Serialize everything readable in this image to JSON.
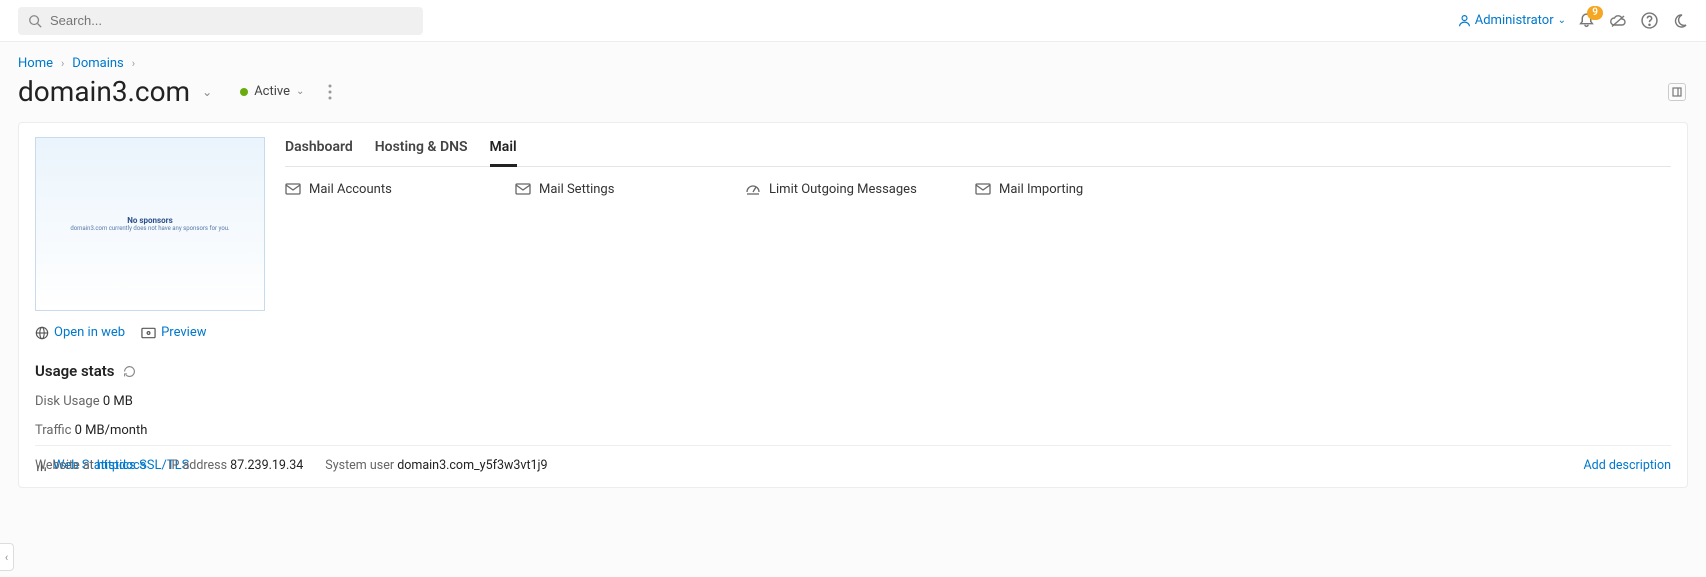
{
  "search": {
    "placeholder": "Search..."
  },
  "user": {
    "name": "Administrator"
  },
  "notifications": {
    "count": "9"
  },
  "breadcrumb": {
    "home": "Home",
    "domains": "Domains"
  },
  "title": "domain3.com",
  "status": {
    "label": "Active"
  },
  "preview": {
    "line1": "No sponsors",
    "line2": "domain3.com currently does not have any sponsors for you."
  },
  "links": {
    "open_in_web": "Open in web",
    "preview": "Preview"
  },
  "usage": {
    "heading": "Usage stats",
    "disk_label": "Disk Usage",
    "disk_value": "0 MB",
    "traffic_label": "Traffic",
    "traffic_value": "0 MB/month",
    "webstat": "Web Statistics SSL/TLS"
  },
  "tabs": {
    "dashboard": "Dashboard",
    "hosting": "Hosting & DNS",
    "mail": "Mail"
  },
  "mail": {
    "accounts": "Mail Accounts",
    "settings": "Mail Settings",
    "limit": "Limit Outgoing Messages",
    "import": "Mail Importing"
  },
  "footer": {
    "website_label": "Website at",
    "website_link": "httpdocs",
    "ip_label": "IP address",
    "ip_value": "87.239.19.34",
    "sysuser_label": "System user",
    "sysuser_value": "domain3.com_y5f3w3vt1j9",
    "add_desc": "Add description"
  }
}
